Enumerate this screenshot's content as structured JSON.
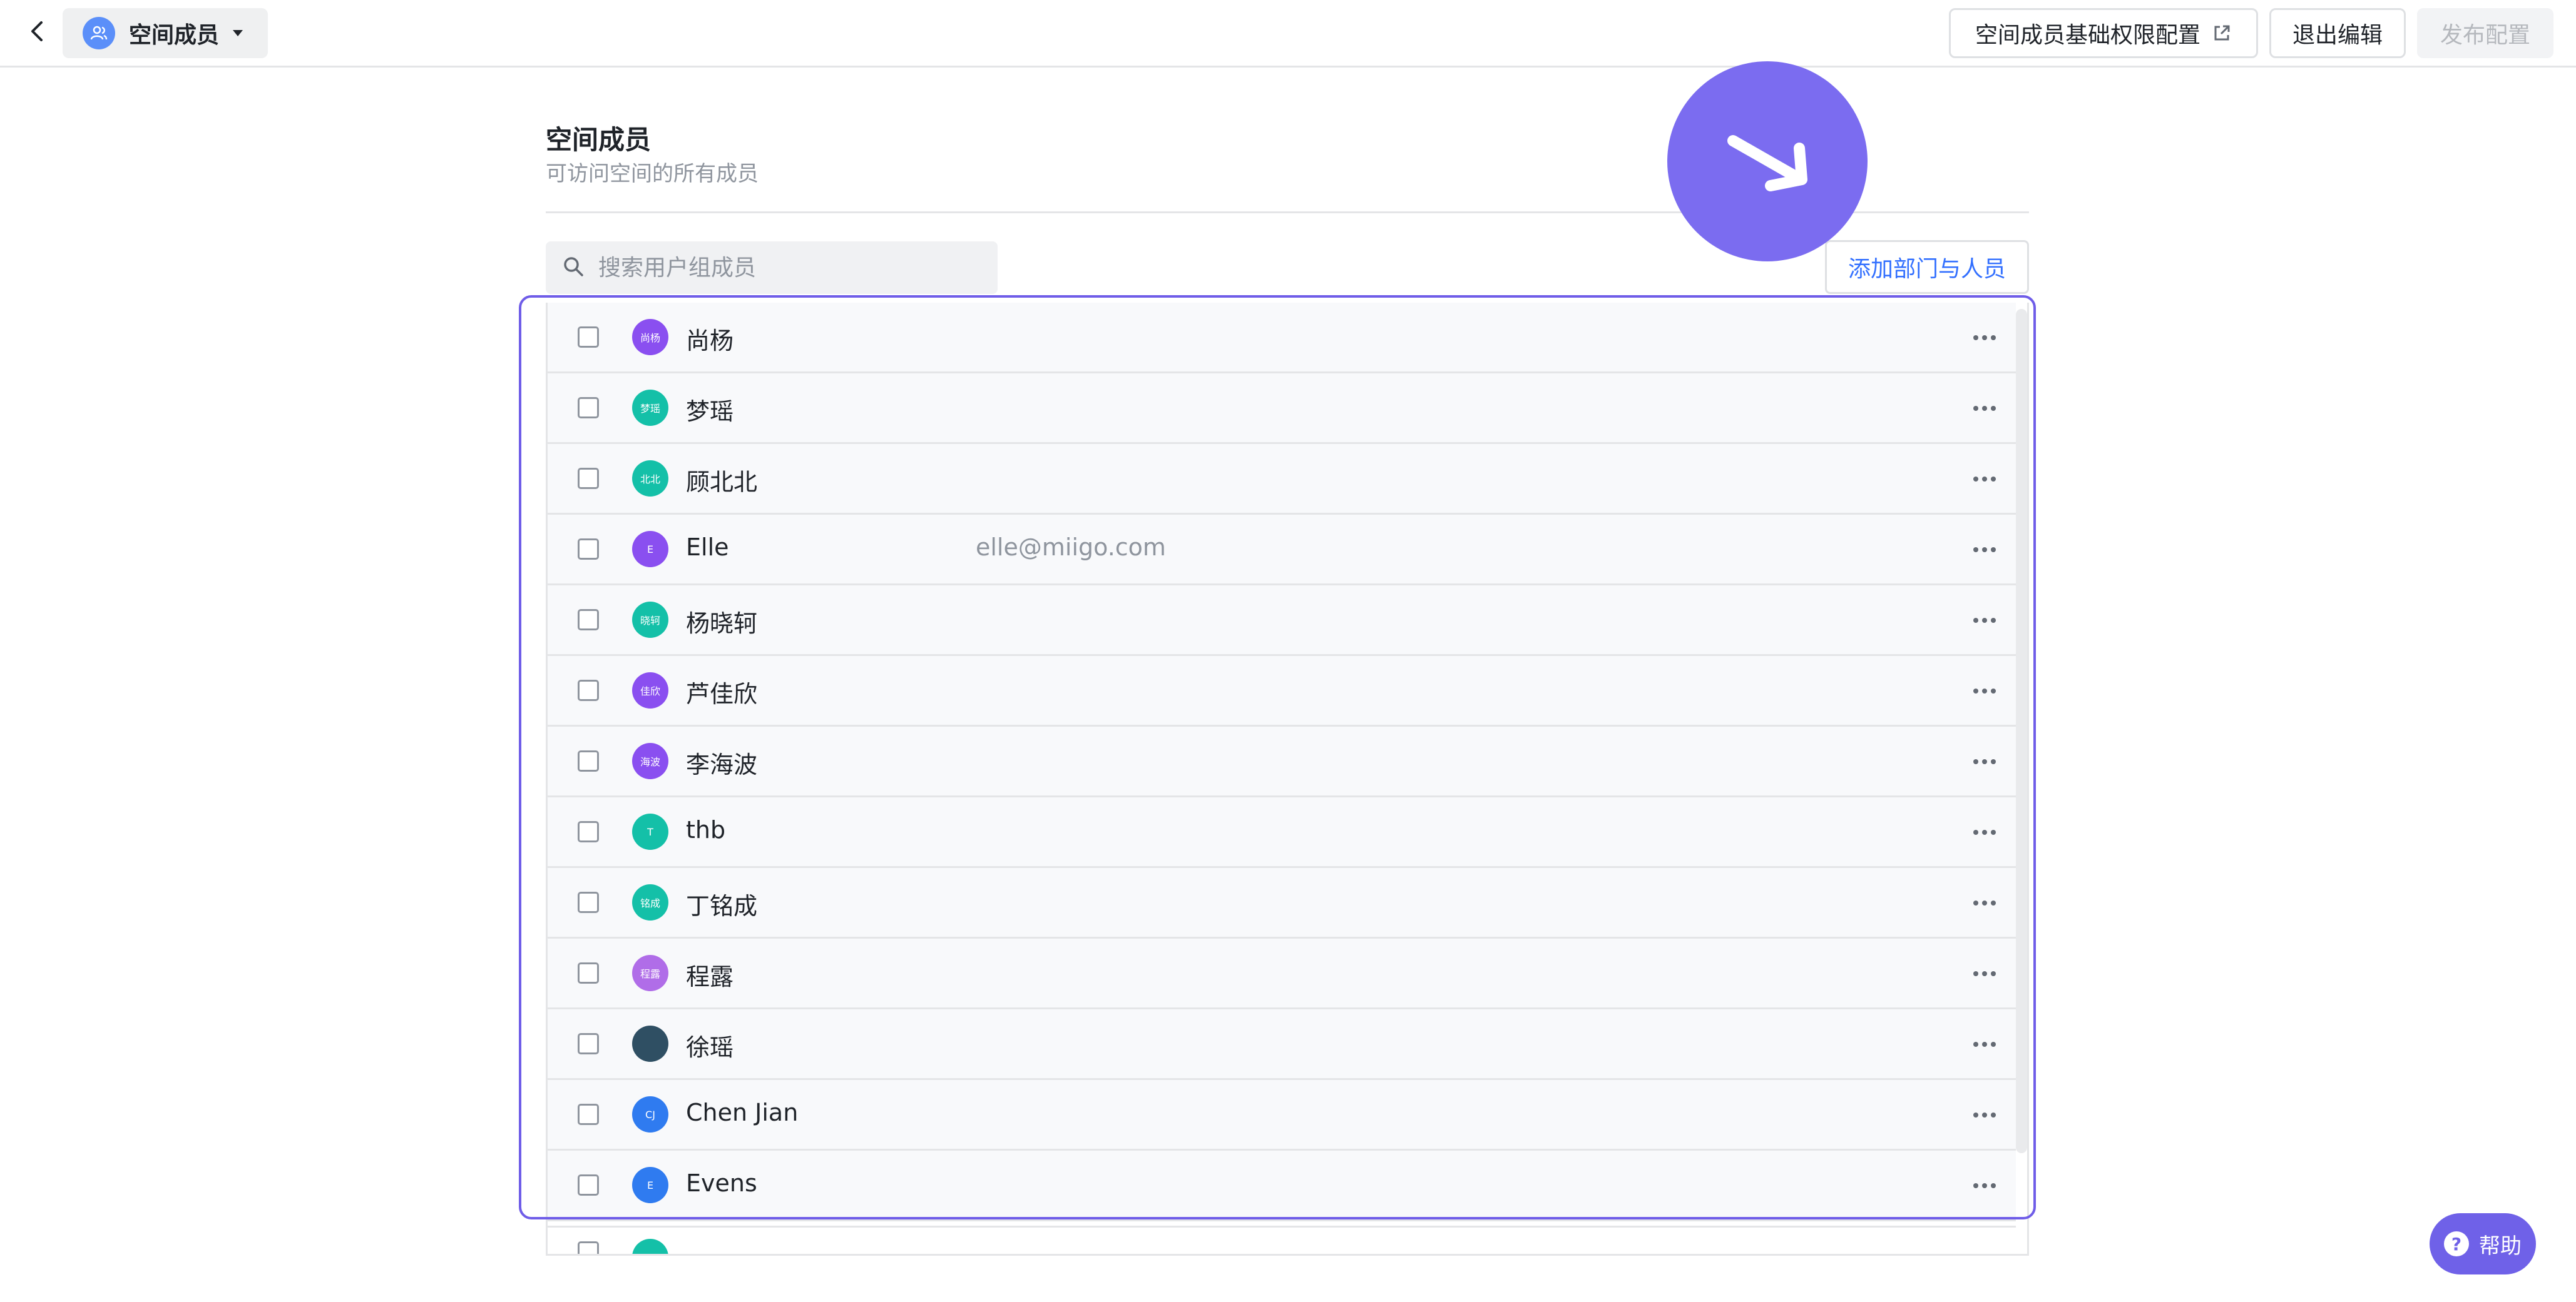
{
  "topbar": {
    "space_name": "空间成员",
    "permission_config_label": "空间成员基础权限配置",
    "exit_edit_label": "退出编辑",
    "publish_label": "发布配置"
  },
  "section": {
    "title": "空间成员",
    "subtitle": "可访问空间的所有成员"
  },
  "search": {
    "placeholder": "搜索用户组成员"
  },
  "add_button_label": "添加部门与人员",
  "members": [
    {
      "avatar_text": "尚杨",
      "avatar_color": "#8a4ff0",
      "name": "尚杨",
      "email": ""
    },
    {
      "avatar_text": "梦瑶",
      "avatar_color": "#14c0a8",
      "name": "梦瑶",
      "email": ""
    },
    {
      "avatar_text": "北北",
      "avatar_color": "#14c0a8",
      "name": "顾北北",
      "email": ""
    },
    {
      "avatar_text": "E",
      "avatar_color": "#8a4ff0",
      "name": "Elle",
      "email": "elle@miigo.com"
    },
    {
      "avatar_text": "晓轲",
      "avatar_color": "#14c0a8",
      "name": "杨晓轲",
      "email": ""
    },
    {
      "avatar_text": "佳欣",
      "avatar_color": "#8a4ff0",
      "name": "芦佳欣",
      "email": ""
    },
    {
      "avatar_text": "海波",
      "avatar_color": "#8a4ff0",
      "name": "李海波",
      "email": ""
    },
    {
      "avatar_text": "T",
      "avatar_color": "#14c0a8",
      "name": "thb",
      "email": ""
    },
    {
      "avatar_text": "铭成",
      "avatar_color": "#14c0a8",
      "name": "丁铭成",
      "email": ""
    },
    {
      "avatar_text": "程露",
      "avatar_color": "#b06de8",
      "name": "程露",
      "email": ""
    },
    {
      "avatar_text": "",
      "avatar_color": "#2f4f63",
      "name": "徐瑶",
      "email": ""
    },
    {
      "avatar_text": "CJ",
      "avatar_color": "#2f7bf0",
      "name": "Chen Jian",
      "email": ""
    },
    {
      "avatar_text": "E",
      "avatar_color": "#2f7bf0",
      "name": "Evens",
      "email": ""
    }
  ],
  "help_label": "帮助",
  "icons": {
    "back": "chevron-left-icon",
    "space": "user-group-icon",
    "caret": "caret-down-icon",
    "external": "external-link-icon",
    "search": "search-icon",
    "more": "more-horizontal-icon",
    "cursor": "cursor-arrow-icon",
    "help": "question-icon"
  },
  "colors": {
    "accent": "#3370ff",
    "selection": "#6f5de8",
    "cursor_bubble": "#7b6cf0",
    "help_button": "#6f61e8"
  }
}
